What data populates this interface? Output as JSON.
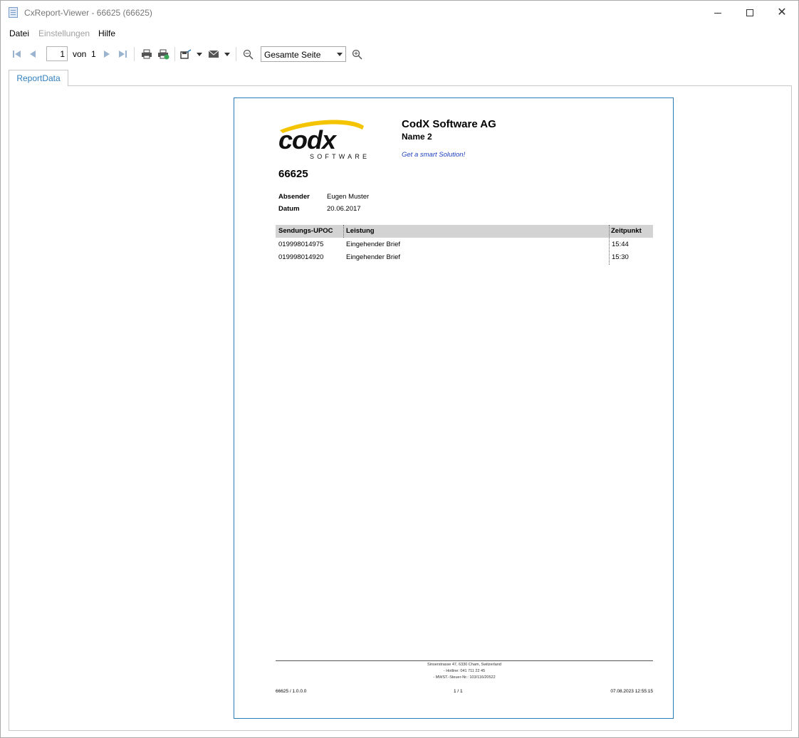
{
  "window": {
    "title": "CxReport-Viewer - 66625 (66625)"
  },
  "menu": {
    "file": "Datei",
    "settings": "Einstellungen",
    "help": "Hilfe"
  },
  "toolbar": {
    "page_current": "1",
    "page_of_label": "von",
    "page_total": "1",
    "zoom_mode": "Gesamte Seite"
  },
  "tabs": [
    {
      "label": "ReportData"
    }
  ],
  "report": {
    "company_name": "CodX Software AG",
    "company_name2": "Name 2",
    "slogan": "Get a smart Solution!",
    "logo_text": "codx",
    "logo_subtext": "SOFTWARE",
    "report_number": "66625",
    "sender_label": "Absender",
    "sender_value": "Eugen Muster",
    "date_label": "Datum",
    "date_value": "20.06.2017",
    "columns": [
      "Sendungs-UPOC",
      "Leistung",
      "Zeitpunkt"
    ],
    "rows": [
      {
        "upoc": "019998014975",
        "service": "Eingehender Brief",
        "time": "15:44"
      },
      {
        "upoc": "019998014920",
        "service": "Eingehender Brief",
        "time": "15:30"
      }
    ],
    "footer_lines": [
      "Sinserstrasse 47, 6330 Cham, Switzerland",
      "- Hotline: 041 711 22 45",
      "- MWST.-Steuer-Nr.: 103/116/20522"
    ],
    "footer_left": "66625 / 1.0.0.0",
    "footer_page": "1 / 1",
    "footer_timestamp": "07.08.2023 12:55:15"
  },
  "colors": {
    "accent": "#2a7ab8",
    "tab_text": "#2f7fbf",
    "slogan": "#1f3fbf",
    "logo_swoosh": "#f5c400"
  }
}
